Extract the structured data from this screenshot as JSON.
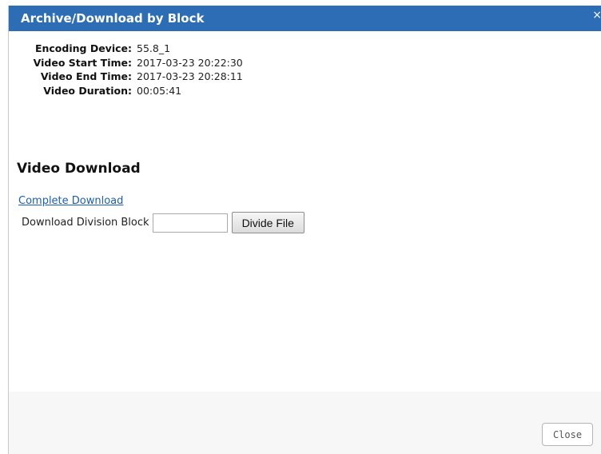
{
  "dialog": {
    "title": "Archive/Download by Block",
    "close_glyph": "×",
    "title_bar_color": "#2d6db5"
  },
  "info": [
    {
      "label": "Encoding Device:",
      "value": "55.8_1"
    },
    {
      "label": "Video Start Time:",
      "value": "2017-03-23 20:22:30"
    },
    {
      "label": "Video End Time:",
      "value": "2017-03-23 20:28:11"
    },
    {
      "label": "Video Duration:",
      "value": "00:05:41"
    }
  ],
  "download": {
    "heading": "Video Download",
    "complete_link": "Complete Download",
    "block_label": "Download Division Block",
    "block_value": "",
    "divide_button": "Divide File"
  },
  "footer": {
    "close_button": "Close"
  }
}
